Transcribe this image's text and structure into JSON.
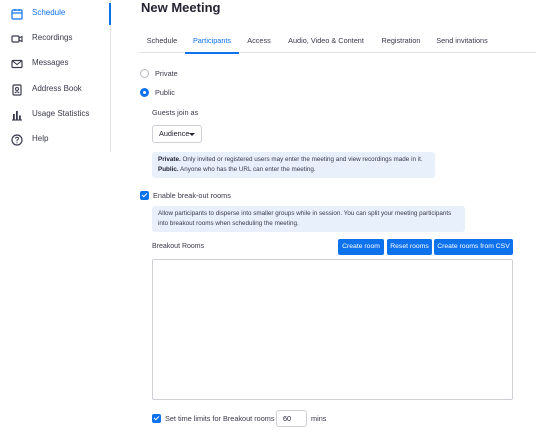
{
  "sidebar": {
    "items": [
      {
        "label": "Schedule",
        "icon": "calendar-icon"
      },
      {
        "label": "Recordings",
        "icon": "video-camera-icon"
      },
      {
        "label": "Messages",
        "icon": "envelope-icon"
      },
      {
        "label": "Address Book",
        "icon": "address-book-icon"
      },
      {
        "label": "Usage Statistics",
        "icon": "bar-chart-icon"
      },
      {
        "label": "Help",
        "icon": "question-circle-icon"
      }
    ]
  },
  "page": {
    "title": "New Meeting"
  },
  "tabs": [
    "Schedule",
    "Participants",
    "Access",
    "Audio, Video & Content",
    "Registration",
    "Send invitations"
  ],
  "access": {
    "private_label": "Private",
    "public_label": "Public",
    "guests_join_label": "Guests join as",
    "guests_join_value": "Audience",
    "info_private_bold": "Private.",
    "info_private_text": " Only invited or registered users may enter the meeting and view recordings made in it.",
    "info_public_bold": "Public.",
    "info_public_text": " Anyone who has the URL can enter the meeting."
  },
  "breakout": {
    "enable_label": "Enable break-out rooms",
    "info_text": "Allow participants to disperse into smaller groups while in session. You can split your meeting participants into breakout rooms when scheduling the meeting.",
    "rooms_label": "Breakout Rooms",
    "create_room": "Create room",
    "reset_rooms": "Reset rooms",
    "create_csv": "Create rooms from CSV",
    "time_limit_label": "Set time limits for Breakout rooms",
    "time_limit_value": "60",
    "time_unit": "mins"
  },
  "colors": {
    "accent": "#0e72ed",
    "info_bg": "#e8f0fb"
  }
}
